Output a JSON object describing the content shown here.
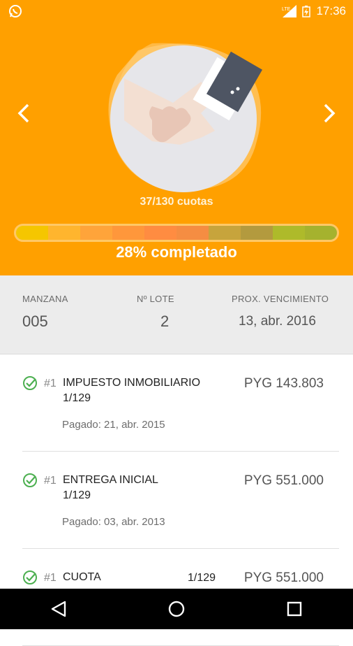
{
  "status_bar": {
    "left_icon": "whatsapp-icon",
    "network_label": "LTE",
    "time": "17:36"
  },
  "hero": {
    "illustration": "handshake-illustration",
    "cuotas_text": "37/130 cuotas",
    "progress_percent": 28,
    "completado_text": "28% completado",
    "segment_colors": [
      "#f5c600",
      "#ffb52e",
      "#ffa43a",
      "#ff973b",
      "#ff8c41",
      "#f58d42",
      "#c7a43c",
      "#b39a3e",
      "#aeba2a",
      "#a5b22e"
    ],
    "accent_color": "#ffa000"
  },
  "summary": {
    "manzana_label": "MANZANA",
    "manzana_value": "005",
    "lote_label": "Nº LOTE",
    "lote_value": "2",
    "vencimiento_label": "PROX. VENCIMIENTO",
    "vencimiento_value": "13, abr. 2016"
  },
  "payments": [
    {
      "number": "#1",
      "name": "IMPUESTO INMOBILIARIO",
      "fraction": "1/129",
      "amount": "PYG 143.803",
      "paid": "Pagado: 21, abr. 2015"
    },
    {
      "number": "#1",
      "name": "ENTREGA INICIAL",
      "fraction": "1/129",
      "amount": "PYG 551.000",
      "paid": "Pagado: 03, abr. 2013"
    },
    {
      "number": "#1",
      "name": "CUOTA",
      "fraction": "1/129",
      "amount": "PYG 551.000",
      "paid": ""
    }
  ],
  "navbar": {
    "back_icon": "back-triangle-icon",
    "home_icon": "home-circle-icon",
    "recents_icon": "recents-square-icon"
  }
}
